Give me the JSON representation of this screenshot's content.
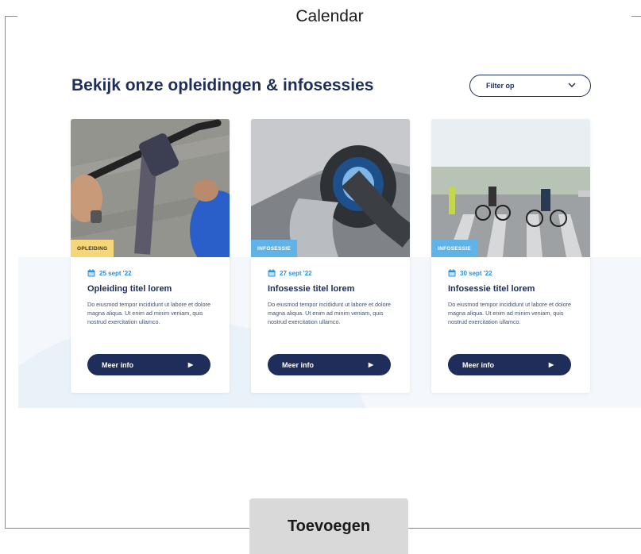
{
  "frame": {
    "title": "Calendar"
  },
  "section": {
    "heading": "Bekijk onze opleidingen & infosessies"
  },
  "filter": {
    "label": "Filter op",
    "icon": "chevron-down-icon"
  },
  "cards": [
    {
      "tag": "OPLEIDING",
      "tag_color": "#f5d678",
      "date": "25 sept '22",
      "title": "Opleiding titel lorem",
      "body": "Do eiusmod tempor incididunt ut labore et dolore magna aliqua. Ut enim ad minim veniam, quis nostrud exercitation ullamco.",
      "button": "Meer info"
    },
    {
      "tag": "INFOSESSIE",
      "tag_color": "#5fb3e6",
      "date": "27 sept '22",
      "title": "Infosessie titel lorem",
      "body": "Do eiusmod tempor incididunt ut labore et dolore magna aliqua. Ut enim ad minim veniam, quis nostrud exercitation ullamco.",
      "button": "Meer info"
    },
    {
      "tag": "INFOSESSIE",
      "tag_color": "#5fb3e6",
      "date": "30 sept '22",
      "title": "Infosessie titel lorem",
      "body": "Do eiusmod tempor incididunt ut labore et dolore magna aliqua. Ut enim ad minim veniam, quis nostrud exercitation ullamco.",
      "button": "Meer info"
    }
  ],
  "footer": {
    "add_button": "Toevoegen"
  },
  "colors": {
    "navy": "#1e2d5a",
    "accent_blue": "#2f8fd6"
  }
}
